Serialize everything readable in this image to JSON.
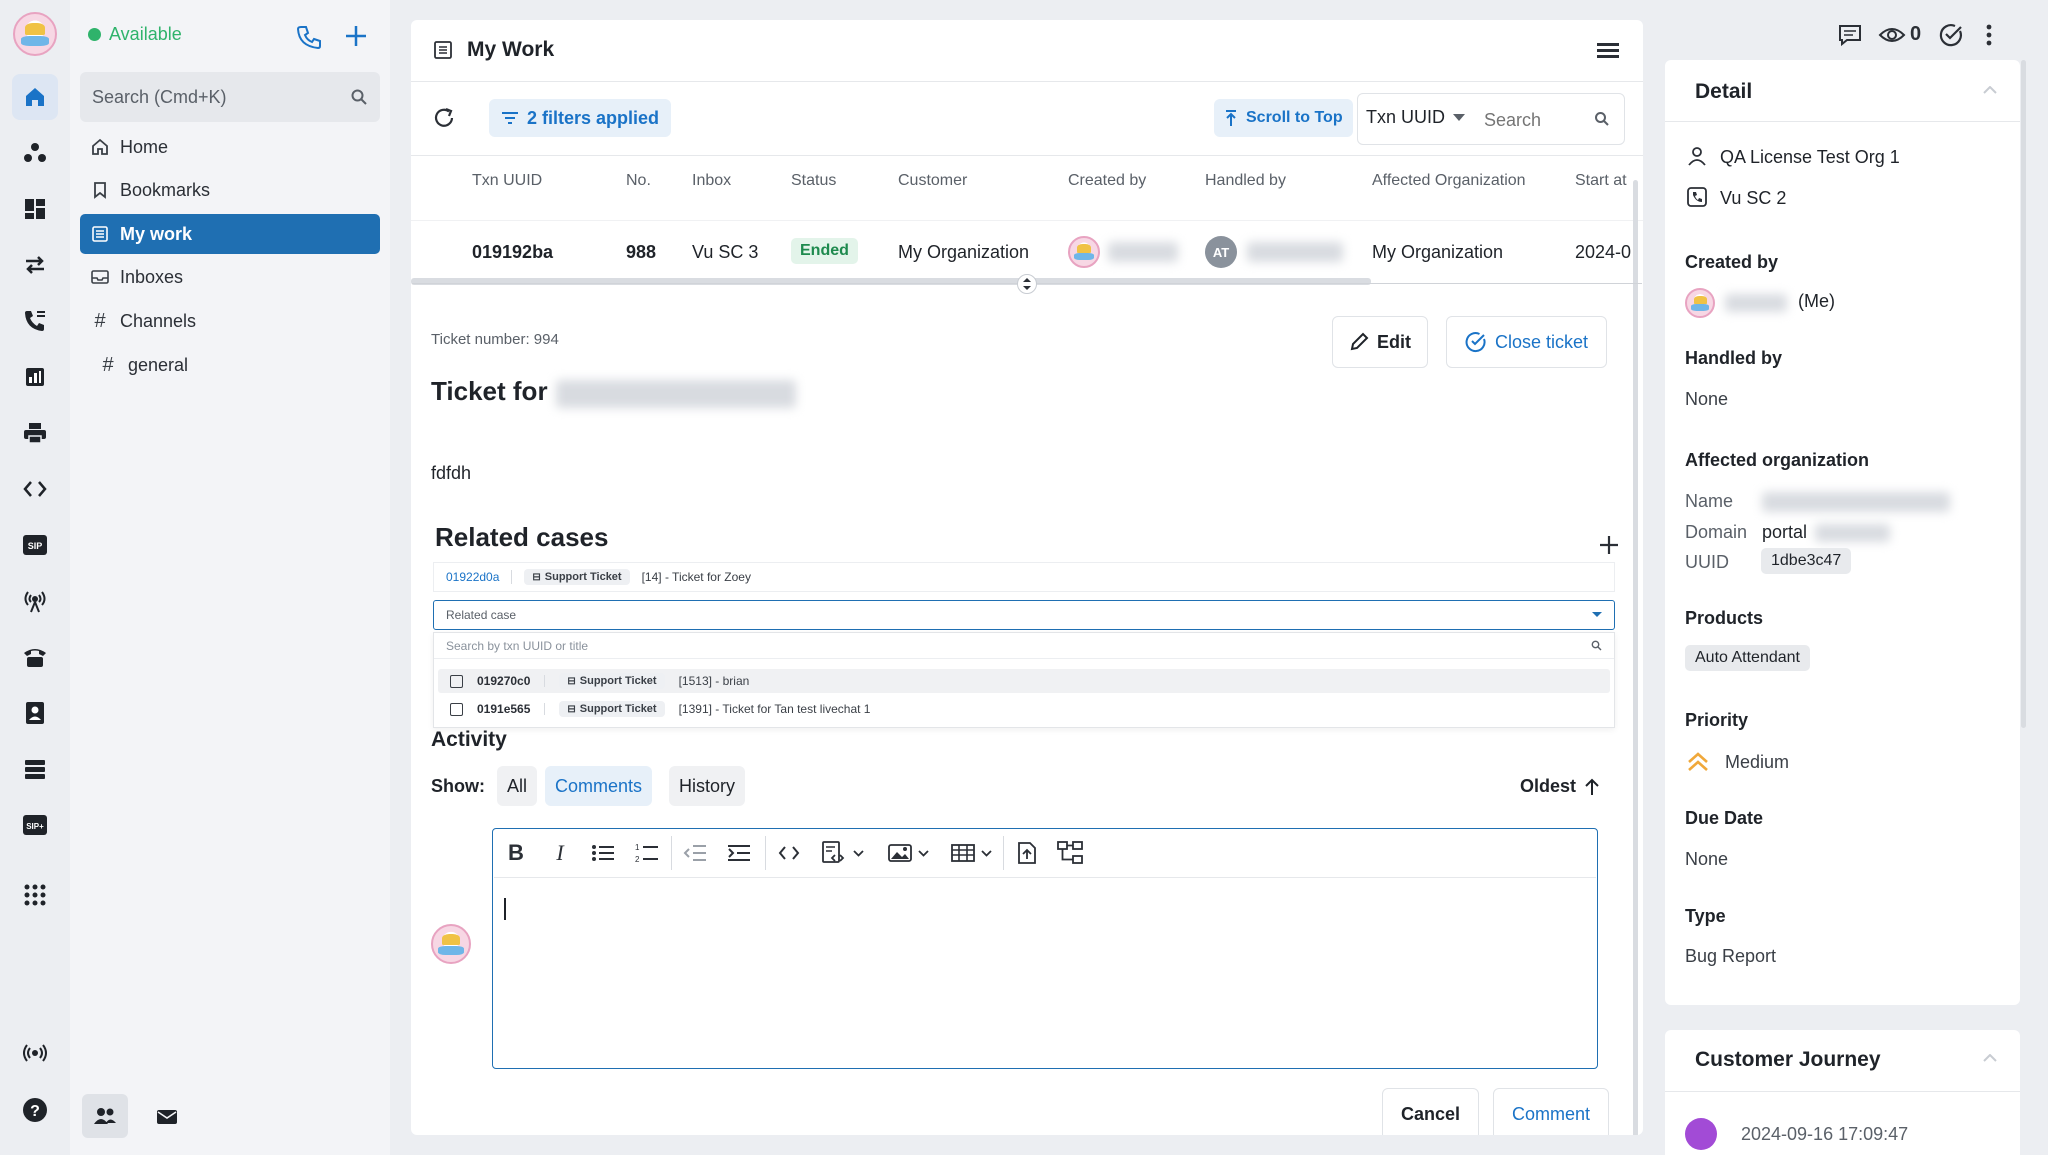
{
  "status": {
    "label": "Available",
    "color": "#2fb36b"
  },
  "search": {
    "placeholder": "Search (Cmd+K)"
  },
  "nav": [
    {
      "label": "Home",
      "icon": "home-outline-icon"
    },
    {
      "label": "Bookmarks",
      "icon": "bookmark-icon"
    },
    {
      "label": "My work",
      "icon": "list-icon",
      "active": true
    },
    {
      "label": "Inboxes",
      "icon": "inbox-icon"
    },
    {
      "label": "Channels",
      "icon": "hash-icon"
    }
  ],
  "channels": [
    {
      "label": "general"
    }
  ],
  "main": {
    "title": "My Work",
    "filters_label": "2 filters applied",
    "scroll_top_label": "Scroll to Top",
    "search_field_select": "Txn UUID",
    "search_placeholder": "Search",
    "columns": [
      "Txn UUID",
      "No.",
      "Inbox",
      "Status",
      "Customer",
      "Created by",
      "Handled by",
      "Affected Organization",
      "Start at"
    ],
    "row": {
      "txn_uuid": "019192ba",
      "no": "988",
      "inbox": "Vu SC 3",
      "status": "Ended",
      "customer": "My Organization",
      "handled_by_initials": "AT",
      "affected_org": "My Organization",
      "start_at": "2024-0"
    }
  },
  "ticket": {
    "number_label": "Ticket number: 994",
    "title_prefix": "Ticket for",
    "description": "fdfdh",
    "edit_label": "Edit",
    "close_label": "Close ticket"
  },
  "related": {
    "heading": "Related cases",
    "existing": {
      "uuid": "01922d0a",
      "tag": "Support Ticket",
      "title": "[14] - Ticket for Zoey"
    },
    "select_placeholder": "Related case",
    "search_placeholder": "Search by txn UUID or title",
    "options": [
      {
        "uuid": "019270c0",
        "tag": "Support Ticket",
        "title": "[1513] - brian"
      },
      {
        "uuid": "0191e565",
        "tag": "Support Ticket",
        "title": "[1391] - Ticket for Tan test livechat 1"
      }
    ]
  },
  "activity": {
    "heading": "Activity",
    "show_label": "Show:",
    "tabs": [
      "All",
      "Comments",
      "History"
    ],
    "active_tab": "Comments",
    "sort_label": "Oldest",
    "cancel_label": "Cancel",
    "comment_label": "Comment"
  },
  "topbar": {
    "watch_count": "0"
  },
  "detail": {
    "heading": "Detail",
    "org": "QA License Test Org 1",
    "inbox": "Vu SC 2",
    "created_by_label": "Created by",
    "created_by_me": "(Me)",
    "handled_by_label": "Handled by",
    "handled_by": "None",
    "affected_org_label": "Affected organization",
    "name_label": "Name",
    "domain_label": "Domain",
    "domain_value": "portal",
    "uuid_label": "UUID",
    "uuid_value": "1dbe3c47",
    "products_label": "Products",
    "product": "Auto Attendant",
    "priority_label": "Priority",
    "priority": "Medium",
    "due_label": "Due Date",
    "due": "None",
    "type_label": "Type",
    "type": "Bug Report",
    "journey_heading": "Customer Journey",
    "journey_time": "2024-09-16 17:09:47"
  },
  "colors": {
    "accent": "#1f6fb2",
    "link": "#1a73c7",
    "ended_bg": "#e3f4ea",
    "ended_fg": "#1e8a4e"
  }
}
